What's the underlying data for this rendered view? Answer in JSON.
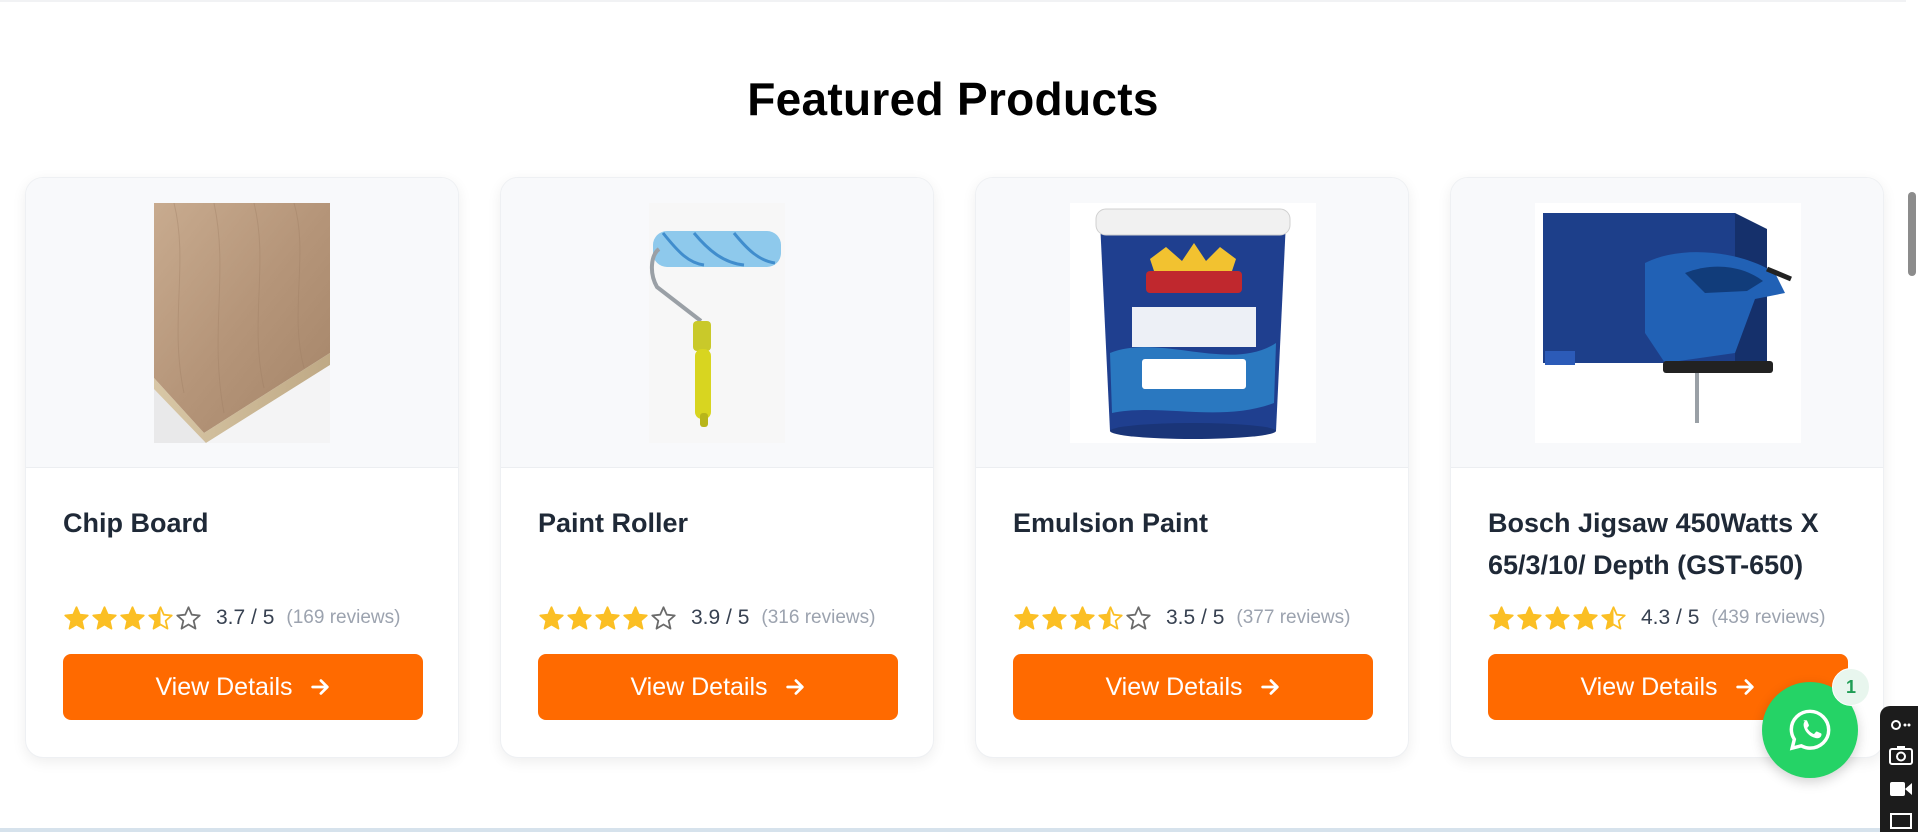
{
  "section": {
    "title": "Featured Products"
  },
  "products": [
    {
      "name": "Chip Board",
      "rating": 3.7,
      "rating_text": "3.7 / 5",
      "reviews_text": "(169 reviews)",
      "button_label": "View Details"
    },
    {
      "name": "Paint Roller",
      "rating": 3.9,
      "rating_text": "3.9 / 5",
      "reviews_text": "(316 reviews)",
      "button_label": "View Details"
    },
    {
      "name": "Emulsion Paint",
      "rating": 3.5,
      "rating_text": "3.5 / 5",
      "reviews_text": "(377 reviews)",
      "button_label": "View Details"
    },
    {
      "name": "Bosch Jigsaw 450Watts X 65/3/10/ Depth (GST-650)",
      "rating": 4.3,
      "rating_text": "4.3 / 5",
      "reviews_text": "(439 reviews)",
      "button_label": "View Details"
    }
  ],
  "whatsapp": {
    "badge_count": "1",
    "icon": "whatsapp-icon"
  },
  "colors": {
    "accent": "#ff6a00",
    "star": "#fbbf24",
    "whatsapp": "#25d366"
  }
}
